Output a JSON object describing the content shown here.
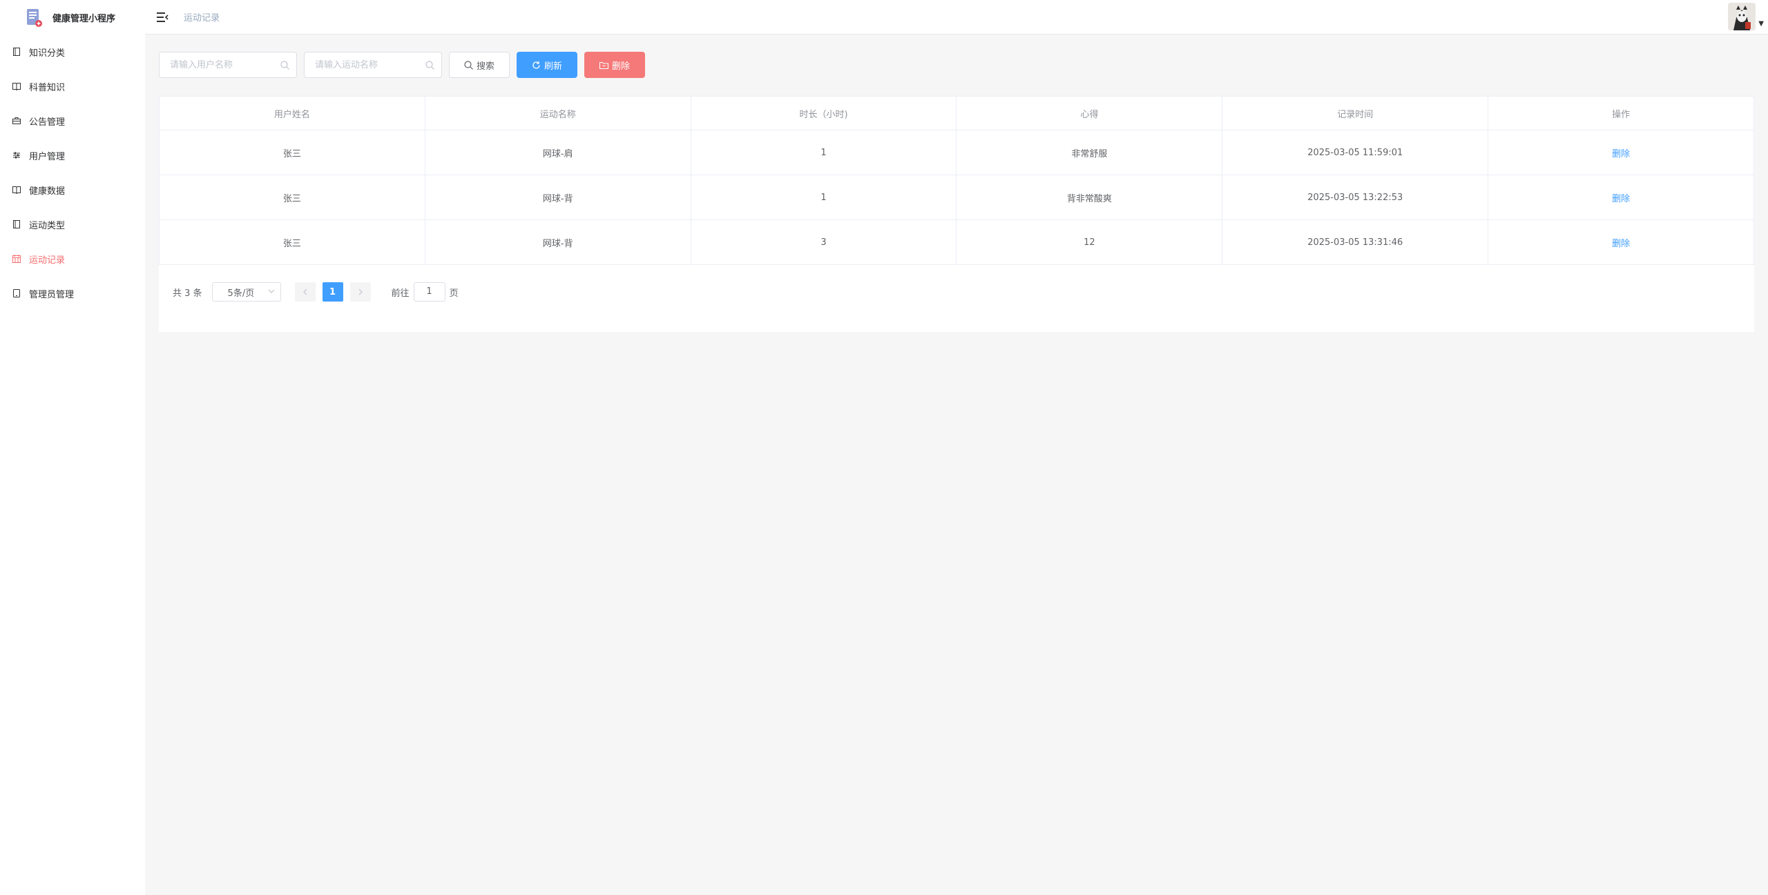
{
  "app": {
    "title": "健康管理小程序"
  },
  "sidebar": {
    "items": [
      {
        "label": "知识分类",
        "icon": "notebook-icon",
        "active": false
      },
      {
        "label": "科普知识",
        "icon": "book-icon",
        "active": false
      },
      {
        "label": "公告管理",
        "icon": "briefcase-icon",
        "active": false
      },
      {
        "label": "用户管理",
        "icon": "sliders-icon",
        "active": false
      },
      {
        "label": "健康数据",
        "icon": "book-icon",
        "active": false
      },
      {
        "label": "运动类型",
        "icon": "notebook-icon",
        "active": false
      },
      {
        "label": "运动记录",
        "icon": "calendar-icon",
        "active": true
      },
      {
        "label": "管理员管理",
        "icon": "tablet-icon",
        "active": false
      }
    ]
  },
  "header": {
    "breadcrumb": "运动记录"
  },
  "toolbar": {
    "user_placeholder": "请输入用户名称",
    "exercise_placeholder": "请输入运动名称",
    "search_label": "搜索",
    "refresh_label": "刷新",
    "delete_label": "删除"
  },
  "table": {
    "columns": [
      "用户姓名",
      "运动名称",
      "时长（小时)",
      "心得",
      "记录时间",
      "操作"
    ],
    "rows": [
      {
        "user": "张三",
        "exercise": "网球-肩",
        "duration": "1",
        "note": "非常舒服",
        "time": "2025-03-05 11:59:01",
        "action": "删除"
      },
      {
        "user": "张三",
        "exercise": "网球-背",
        "duration": "1",
        "note": "背非常酸爽",
        "time": "2025-03-05 13:22:53",
        "action": "删除"
      },
      {
        "user": "张三",
        "exercise": "网球-背",
        "duration": "3",
        "note": "12",
        "time": "2025-03-05 13:31:46",
        "action": "删除"
      }
    ]
  },
  "pagination": {
    "total": "共 3 条",
    "page_size": "5条/页",
    "current_page": "1",
    "goto_label": "前往",
    "goto_value": "1",
    "page_suffix": "页"
  },
  "colors": {
    "primary": "#409eff",
    "danger": "#f56c6c",
    "active_menu": "#f56c6c"
  }
}
